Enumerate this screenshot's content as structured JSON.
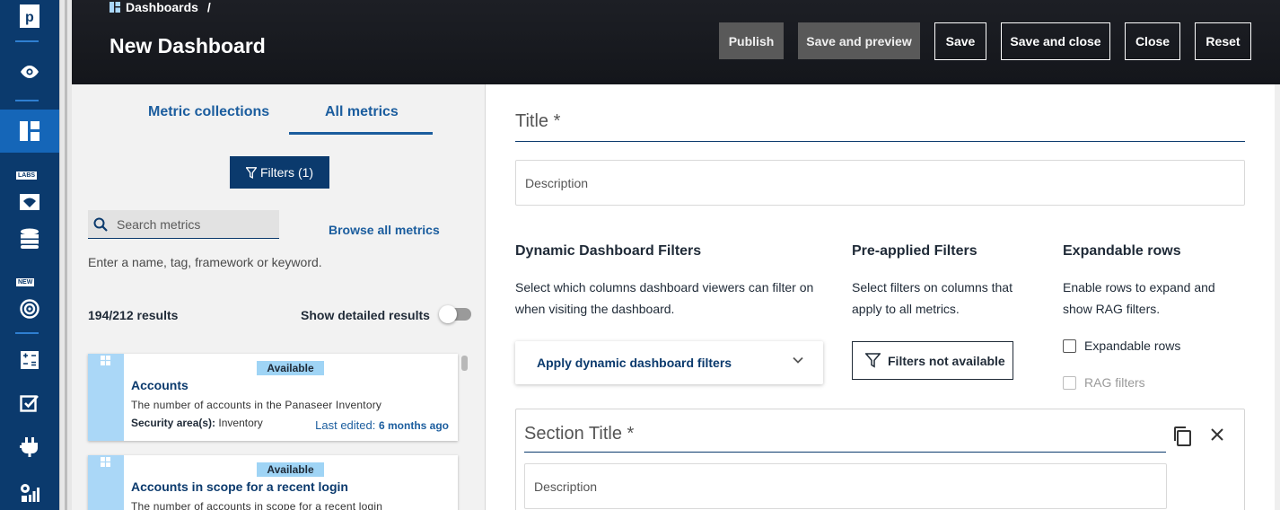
{
  "breadcrumb": {
    "parent": "Dashboards",
    "separator": "/"
  },
  "page_title": "New Dashboard",
  "header_buttons": {
    "publish": "Publish",
    "save_and_preview": "Save and preview",
    "save": "Save",
    "save_and_close": "Save and close",
    "close": "Close",
    "reset": "Reset"
  },
  "rail": {
    "logo": "p",
    "badges": {
      "labs": "LABS",
      "new": "NEW"
    },
    "icons": [
      "logo-icon",
      "eye-icon",
      "dashboard-icon",
      "labs-icon",
      "database-icon",
      "target-icon",
      "calculator-icon",
      "checklist-icon",
      "plug-icon",
      "settings-chart-icon"
    ]
  },
  "left_panel": {
    "tabs": [
      "Metric collections",
      "All metrics"
    ],
    "active_tab": "All metrics",
    "filters_button": "Filters (1)",
    "search_placeholder": "Search metrics",
    "browse_all": "Browse all metrics",
    "hint": "Enter a name, tag, framework or keyword.",
    "results": "194/212 results",
    "show_detailed": "Show detailed results",
    "show_detailed_on": false,
    "cards": [
      {
        "badge": "Available",
        "title": "Accounts",
        "description": "The number of accounts in the Panaseer Inventory",
        "security_label": "Security area(s):",
        "security_value": "Inventory",
        "edited_label": "Last edited:",
        "edited_value": "6 months ago"
      },
      {
        "badge": "Available",
        "title": "Accounts in scope for a recent login",
        "description": "The number of accounts in scope for a recent login"
      }
    ]
  },
  "form": {
    "title_placeholder": "Title *",
    "description_placeholder": "Description",
    "dynamic": {
      "heading": "Dynamic Dashboard Filters",
      "text_line1": "Select which columns dashboard viewers can filter on",
      "text_line2": "when visiting the dashboard.",
      "button": "Apply dynamic dashboard filters"
    },
    "preapplied": {
      "heading": "Pre-applied Filters",
      "text_line1": "Select filters on columns that",
      "text_line2": "apply to all metrics.",
      "button": "Filters not available"
    },
    "expandable": {
      "heading": "Expandable rows",
      "text_line1": "Enable rows to expand and",
      "text_line2": "show RAG filters.",
      "checkbox_expandable": "Expandable rows",
      "checkbox_rag": "RAG filters"
    },
    "section": {
      "title_placeholder": "Section Title *",
      "description_placeholder": "Description"
    }
  },
  "colors": {
    "rail": "#0b3a6d",
    "rail_active": "#1566b8",
    "header": "#1d1f25",
    "accent": "#1b5d9e",
    "badge": "#9fd4f5"
  }
}
